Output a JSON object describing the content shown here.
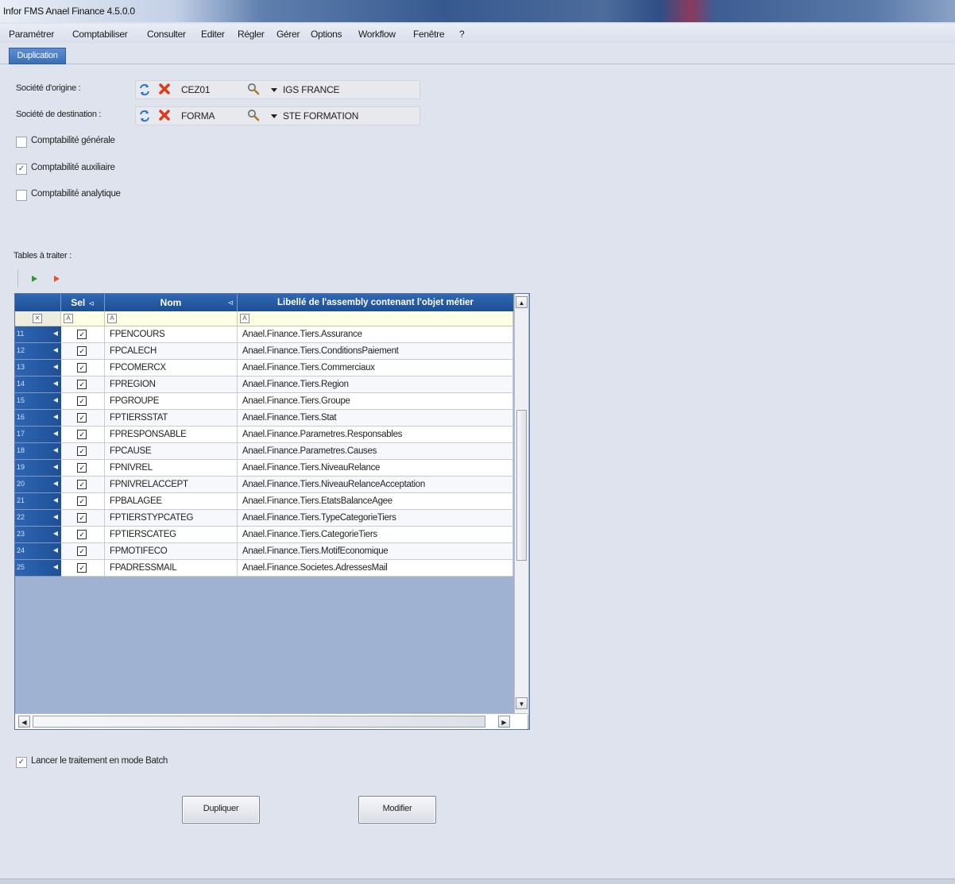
{
  "window": {
    "title": "Infor FMS Anael Finance 4.5.0.0"
  },
  "menu": [
    "Paramétrer",
    "Comptabiliser",
    "Consulter",
    "Editer",
    "Régler",
    "Gérer",
    "Options",
    "Workflow",
    "Fenêtre",
    "?"
  ],
  "tab": {
    "label": "Duplication"
  },
  "origin": {
    "label": "Société d'origine :",
    "code": "CEZ01",
    "name": "IGS FRANCE"
  },
  "destination": {
    "label": "Société de destination :",
    "code": "FORMA",
    "name": "STE FORMATION"
  },
  "options": {
    "general": {
      "label": "Comptabilité générale",
      "checked": false
    },
    "auxiliary": {
      "label": "Comptabilité auxiliaire",
      "checked": true
    },
    "analytic": {
      "label": "Comptabilité analytique",
      "checked": false
    }
  },
  "tables_label": "Tables à traiter :",
  "grid": {
    "columns": {
      "sel": "Sel",
      "nom": "Nom",
      "lib": "Libellé de l'assembly contenant l'objet métier"
    },
    "rows": [
      {
        "n": "11",
        "nom": "FPENCOURS",
        "lib": "Anael.Finance.Tiers.Assurance"
      },
      {
        "n": "12",
        "nom": "FPCALECH",
        "lib": "Anael.Finance.Tiers.ConditionsPaiement"
      },
      {
        "n": "13",
        "nom": "FPCOMERCX",
        "lib": "Anael.Finance.Tiers.Commerciaux"
      },
      {
        "n": "14",
        "nom": "FPREGION",
        "lib": "Anael.Finance.Tiers.Region"
      },
      {
        "n": "15",
        "nom": "FPGROUPE",
        "lib": "Anael.Finance.Tiers.Groupe"
      },
      {
        "n": "16",
        "nom": "FPTIERSSTAT",
        "lib": "Anael.Finance.Tiers.Stat"
      },
      {
        "n": "17",
        "nom": "FPRESPONSABLE",
        "lib": "Anael.Finance.Parametres.Responsables"
      },
      {
        "n": "18",
        "nom": "FPCAUSE",
        "lib": "Anael.Finance.Parametres.Causes"
      },
      {
        "n": "19",
        "nom": "FPNIVREL",
        "lib": "Anael.Finance.Tiers.NiveauRelance"
      },
      {
        "n": "20",
        "nom": "FPNIVRELACCEPT",
        "lib": "Anael.Finance.Tiers.NiveauRelanceAcceptation"
      },
      {
        "n": "21",
        "nom": "FPBALAGEE",
        "lib": "Anael.Finance.Tiers.EtatsBalanceAgee"
      },
      {
        "n": "22",
        "nom": "FPTIERSTYPCATEG",
        "lib": "Anael.Finance.Tiers.TypeCategorieTiers"
      },
      {
        "n": "23",
        "nom": "FPTIERSCATEG",
        "lib": "Anael.Finance.Tiers.CategorieTiers"
      },
      {
        "n": "24",
        "nom": "FPMOTIFECO",
        "lib": "Anael.Finance.Tiers.MotifEconomique"
      },
      {
        "n": "25",
        "nom": "FPADRESSMAIL",
        "lib": "Anael.Finance.Societes.AdressesMail"
      }
    ]
  },
  "batch": {
    "label": "Lancer le traitement en mode Batch",
    "checked": true
  },
  "buttons": {
    "duplicate": "Dupliquer",
    "modify": "Modifier"
  }
}
